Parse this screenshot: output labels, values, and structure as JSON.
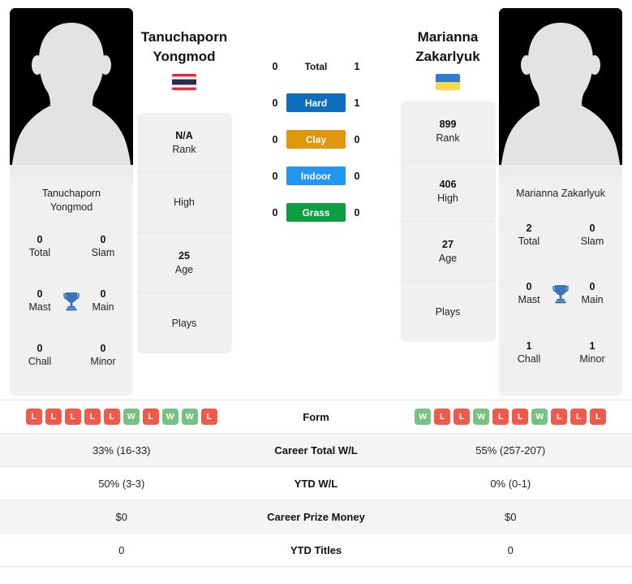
{
  "players": {
    "left": {
      "name_line1": "Tanuchaporn",
      "name_line2": "Yongmod",
      "full_name_line1": "Tanuchaporn",
      "full_name_line2": "Yongmod",
      "flag": "thailand-flag",
      "rank": "N/A",
      "rank_label": "Rank",
      "high": "",
      "high_label": "High",
      "age": "25",
      "age_label": "Age",
      "plays": "",
      "plays_label": "Plays",
      "titles": {
        "total": "0",
        "total_label": "Total",
        "slam": "0",
        "slam_label": "Slam",
        "mast": "0",
        "mast_label": "Mast",
        "main": "0",
        "main_label": "Main",
        "chall": "0",
        "chall_label": "Chall",
        "minor": "0",
        "minor_label": "Minor"
      }
    },
    "right": {
      "name_line1": "Marianna",
      "name_line2": "Zakarlyuk",
      "full_name_line1": "Marianna Zakarlyuk",
      "full_name_line2": "",
      "flag": "ukraine-flag",
      "rank": "899",
      "rank_label": "Rank",
      "high": "406",
      "high_label": "High",
      "age": "27",
      "age_label": "Age",
      "plays": "",
      "plays_label": "Plays",
      "titles": {
        "total": "2",
        "total_label": "Total",
        "slam": "0",
        "slam_label": "Slam",
        "mast": "0",
        "mast_label": "Mast",
        "main": "0",
        "main_label": "Main",
        "chall": "1",
        "chall_label": "Chall",
        "minor": "1",
        "minor_label": "Minor"
      }
    }
  },
  "surfaces": [
    {
      "label": "Total",
      "left": "0",
      "right": "1",
      "color": "transparent",
      "plain": true
    },
    {
      "label": "Hard",
      "left": "0",
      "right": "1",
      "color": "#0d6ec0",
      "plain": false
    },
    {
      "label": "Clay",
      "left": "0",
      "right": "0",
      "color": "#e0960c",
      "plain": false
    },
    {
      "label": "Indoor",
      "left": "0",
      "right": "0",
      "color": "#2196f3",
      "plain": false
    },
    {
      "label": "Grass",
      "left": "0",
      "right": "0",
      "color": "#0f9d41",
      "plain": false
    }
  ],
  "comparison": {
    "form_label": "Form",
    "left_form": [
      "L",
      "L",
      "L",
      "L",
      "L",
      "W",
      "L",
      "W",
      "W",
      "L"
    ],
    "right_form": [
      "W",
      "L",
      "L",
      "W",
      "L",
      "L",
      "W",
      "L",
      "L",
      "L"
    ],
    "rows": [
      {
        "label": "Career Total W/L",
        "left": "33% (16-33)",
        "right": "55% (257-207)"
      },
      {
        "label": "YTD W/L",
        "left": "50% (3-3)",
        "right": "0% (0-1)"
      },
      {
        "label": "Career Prize Money",
        "left": "$0",
        "right": "$0"
      },
      {
        "label": "YTD Titles",
        "left": "0",
        "right": "0"
      }
    ]
  },
  "colors": {
    "win": "#76c282",
    "loss": "#ef5a4a",
    "hard": "#0d6ec0",
    "clay": "#e0960c",
    "indoor": "#2196f3",
    "grass": "#0f9d41",
    "card_bg": "#f0f0f0",
    "trophy": "#3d74b8"
  }
}
